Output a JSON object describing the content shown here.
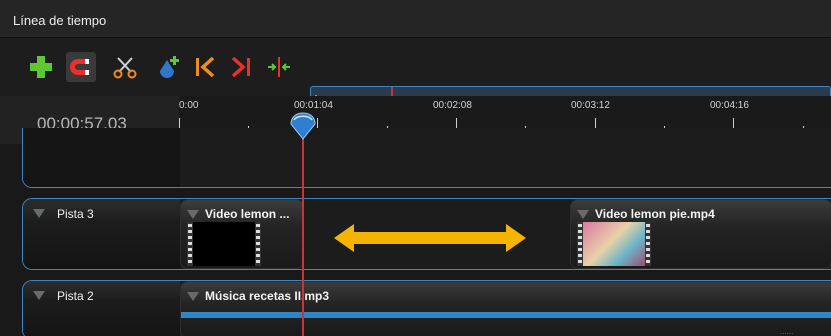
{
  "panel": {
    "title": "Línea de tiempo"
  },
  "toolbar": {
    "buttons": [
      "add-track",
      "snap-magnet",
      "razor",
      "add-marker",
      "previous-marker",
      "next-marker",
      "center-playhead"
    ]
  },
  "timecode": "00:00:57,03",
  "ruler": {
    "labels": [
      "0:00",
      "00:01:04",
      "00:02:08",
      "00:03:12",
      "00:04:16"
    ]
  },
  "tracks": [
    {
      "name": "Pista 3",
      "clips": [
        {
          "title": "Video lemon ..."
        },
        {
          "title": "Video lemon pie.mp4"
        }
      ]
    },
    {
      "name": "Pista 2",
      "clips": [
        {
          "title": "Música recetas II.mp3"
        }
      ]
    }
  ],
  "colors": {
    "accent": "#3d87c9",
    "playhead": "#c8343a",
    "annotation_arrow": "#f5b400"
  }
}
